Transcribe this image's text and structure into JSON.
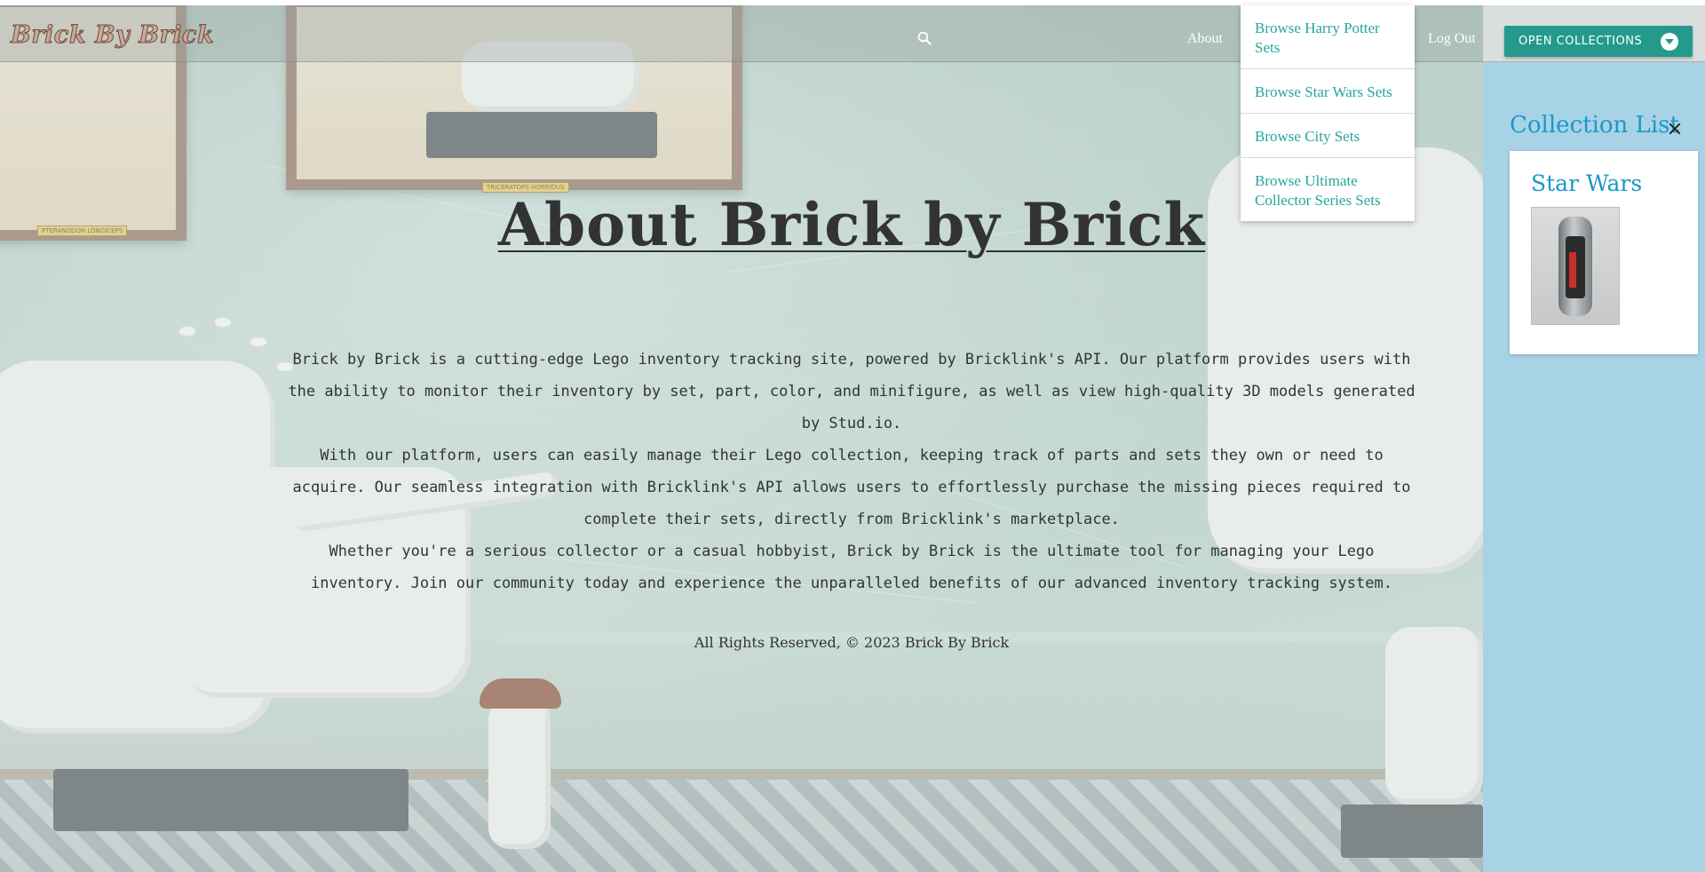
{
  "brand": {
    "name": "Brick By Brick"
  },
  "navbar": {
    "search_icon": "search-icon",
    "links": {
      "about": "About",
      "log_out": "Log Out"
    },
    "open_collections_label": "OPEN COLLECTIONS",
    "accent_color": "#239a8c"
  },
  "dropdown": {
    "items": [
      "Browse Harry Potter Sets",
      "Browse Star Wars Sets",
      "Browse City Sets",
      "Browse Ultimate Collector Series Sets"
    ]
  },
  "main": {
    "title": "About Brick by Brick",
    "paragraphs": [
      "Brick by Brick is a cutting-edge Lego inventory tracking site, powered by Bricklink's API. Our platform provides users with the ability to monitor their inventory by set, part, color, and minifigure, as well as view high-quality 3D models generated by Stud.io.",
      "With our platform, users can easily manage their Lego collection, keeping track of parts and sets they own or need to acquire. Our seamless integration with Bricklink's API allows users to effortlessly purchase the missing pieces required to complete their sets, directly from Bricklink's marketplace.",
      "Whether you're a serious collector or a casual hobbyist, Brick by Brick is the ultimate tool for managing your Lego inventory. Join our community today and experience the unparalleled benefits of our advanced inventory tracking system."
    ],
    "footer": "All Rights Reserved, © 2023 Brick By Brick"
  },
  "background": {
    "plaques": [
      "PTERANODON LONGICEPS",
      "TRICERATOPS HORRIDUS"
    ]
  },
  "sidebar": {
    "title": "Collection List",
    "close_icon": "close-icon",
    "collections": [
      {
        "name": "Star Wars",
        "thumbnail": "star-wars-set-image"
      }
    ],
    "background_color": "#a8d2e6",
    "title_color": "#1c98c8"
  }
}
